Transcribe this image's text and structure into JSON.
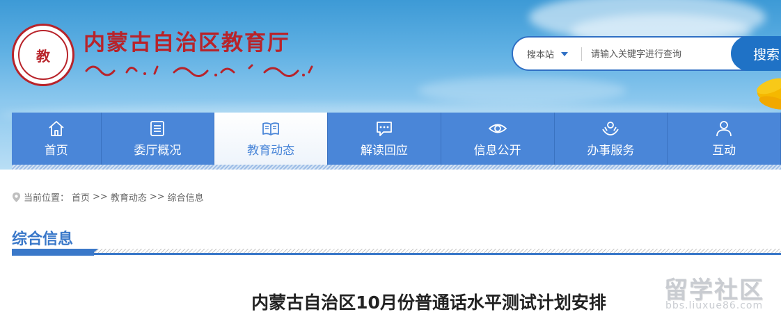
{
  "header": {
    "site_title": "内蒙古自治区教育厅",
    "emblem_text": "教",
    "colors": {
      "brand_red": "#b8232a",
      "nav_blue": "#4a86d8",
      "accent_blue": "#1f72c6"
    }
  },
  "search": {
    "scope_label": "搜本站",
    "placeholder": "请输入关键字进行查询",
    "button_label": "搜索"
  },
  "nav": {
    "items": [
      {
        "label": "首页",
        "icon": "home-icon"
      },
      {
        "label": "委厅概况",
        "icon": "list-icon"
      },
      {
        "label": "教育动态",
        "icon": "book-icon",
        "active": true
      },
      {
        "label": "解读回应",
        "icon": "chat-icon"
      },
      {
        "label": "信息公开",
        "icon": "eye-icon"
      },
      {
        "label": "办事服务",
        "icon": "service-icon"
      },
      {
        "label": "互动",
        "icon": "user-icon"
      }
    ]
  },
  "breadcrumb": {
    "prefix": "当前位置：",
    "items": [
      "首页",
      "教育动态",
      "综合信息"
    ],
    "separator": ">>"
  },
  "section": {
    "title": "综合信息"
  },
  "article": {
    "title": "内蒙古自治区10月份普通话水平测试计划安排"
  },
  "watermark": {
    "main": "留学社区",
    "sub": "bbs.liuxue86.com"
  }
}
